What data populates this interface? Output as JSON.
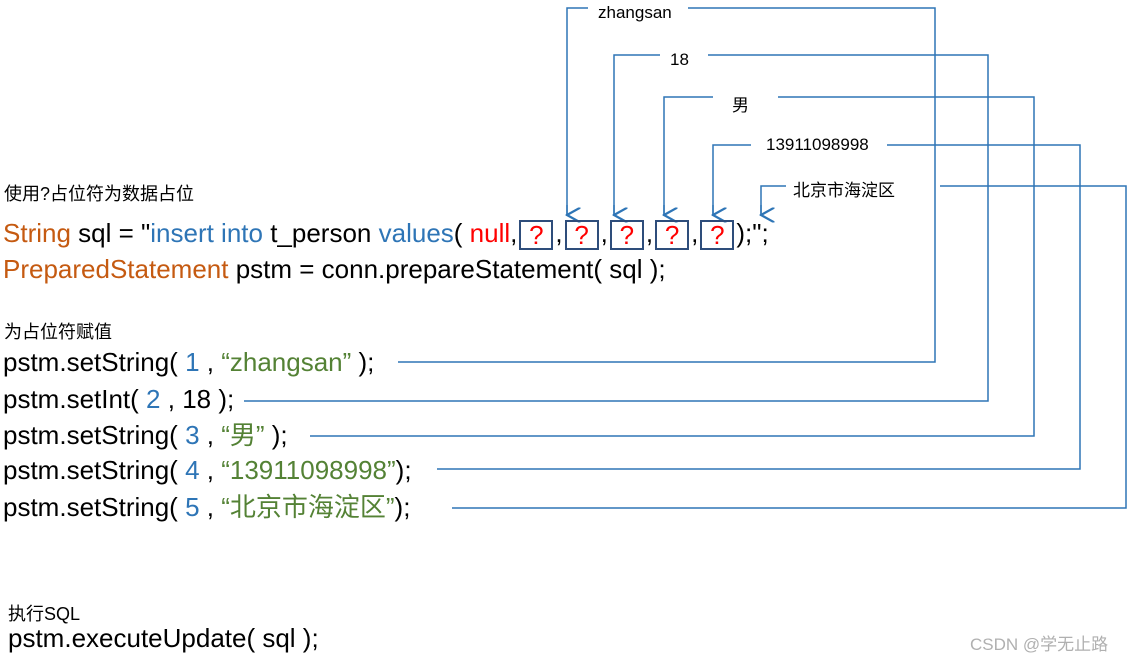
{
  "note_placeholder": "使用?占位符为数据占位",
  "sql_line": {
    "kw_string": "String",
    "var_part": " sql = \"",
    "kw_insert": "insert into",
    "table": " t_person ",
    "kw_values": "values",
    "open": "( ",
    "kw_null": "null",
    "comma": ",",
    "placeholder": "?",
    "close": ");\";"
  },
  "prepared_line": {
    "kw_type": "PreparedStatement",
    "rest": " pstm = conn.prepareStatement( sql );"
  },
  "note_assign": "为占位符赋值",
  "setters": [
    {
      "method": "pstm.setString( ",
      "index": "1",
      "sep": " , ",
      "value": "“zhangsan”",
      "tail": " );"
    },
    {
      "method": "pstm.setInt( ",
      "index": "2",
      "sep": " , ",
      "value": "18",
      "tail": " );"
    },
    {
      "method": "pstm.setString( ",
      "index": "3",
      "sep": " , ",
      "value": "“男”",
      "tail": " );"
    },
    {
      "method": "pstm.setString( ",
      "index": "4",
      "sep": " , ",
      "value": "“13911098998”",
      "tail": ");"
    },
    {
      "method": "pstm.setString( ",
      "index": "5",
      "sep": " , ",
      "value": "“北京市海淀区”",
      "tail": ");"
    }
  ],
  "param_labels": [
    "zhangsan",
    "18",
    "男",
    "13911098998",
    "北京市海淀区"
  ],
  "note_execute": "执行SQL",
  "execute_line": "pstm.executeUpdate( sql );",
  "watermark": "CSDN @学无止路",
  "colors": {
    "keyword": "#c55a11",
    "sql_keyword": "#2e75b6",
    "null_and_placeholder": "#ff0000",
    "string_value": "#548235",
    "connector": "#2e75b6"
  }
}
